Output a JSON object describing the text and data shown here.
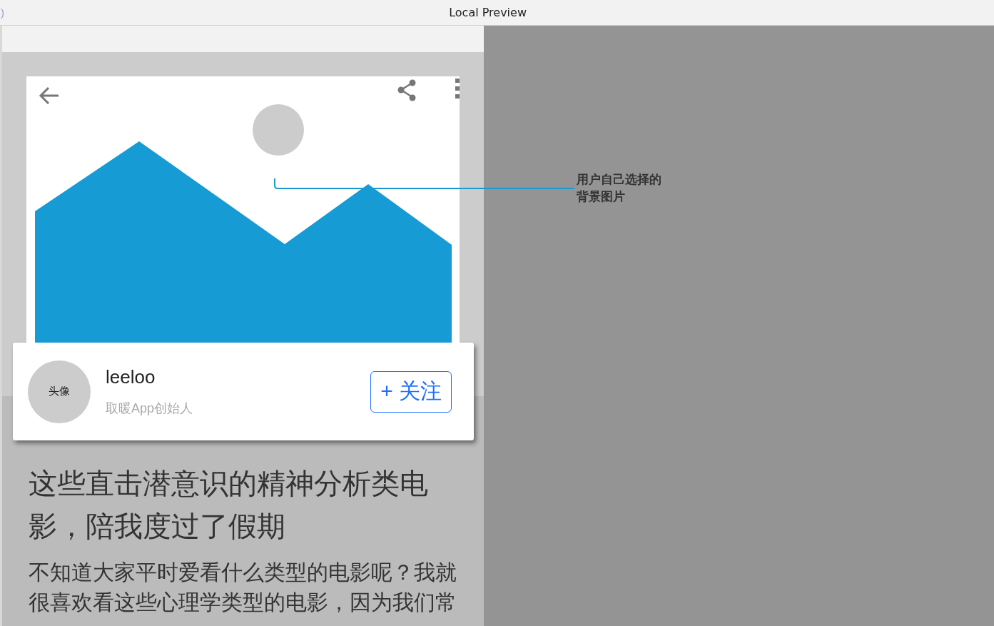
{
  "window": {
    "title_fragment": ")",
    "title": "Local Preview"
  },
  "annotation": {
    "text": "用户自己选择的背景图片"
  },
  "profile": {
    "avatar_label": "头像",
    "name": "leeloo",
    "subtitle": "取暖App创始人",
    "follow_button": "+ 关注"
  },
  "article": {
    "title": "这些直击潜意识的精神分析类电影，陪我度过了假期",
    "body": "不知道大家平时爱看什么类型的电影呢？我就很喜欢看这些心理学类型的电影，因为我们常"
  }
}
